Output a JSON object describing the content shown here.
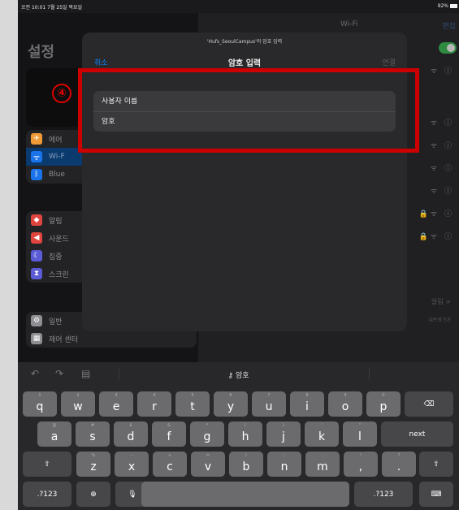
{
  "status": {
    "time": "오전 10:01  7월 25일 목요일",
    "battery": "92%"
  },
  "left": {
    "title": "설정",
    "items_group1": [
      {
        "label": "에어",
        "icon": "airplane-icon",
        "color": "#f09a37"
      },
      {
        "label": "Wi-F",
        "icon": "wifi-icon",
        "color": "#1a73e8"
      },
      {
        "label": "Blue",
        "icon": "bluetooth-icon",
        "color": "#1a73e8"
      }
    ],
    "items_group2": [
      {
        "label": "알림",
        "icon": "bell-icon",
        "color": "#e0443e"
      },
      {
        "label": "사운드",
        "icon": "sound-icon",
        "color": "#e0443e"
      },
      {
        "label": "집중",
        "icon": "moon-icon",
        "color": "#5b5bd6"
      },
      {
        "label": "스크린",
        "icon": "hourglass-icon",
        "color": "#5b5bd6"
      }
    ],
    "items_group3": [
      {
        "label": "일반",
        "icon": "gear-icon",
        "color": "#8e8e93"
      },
      {
        "label": "제어 센터",
        "icon": "control-center-icon",
        "color": "#8e8e93"
      }
    ]
  },
  "right": {
    "title": "Wi-Fi",
    "edit": "편집",
    "bottom_text": "알림 >",
    "small_text": "네트워크가"
  },
  "modal": {
    "subtitle": "'Hufs_SeoulCampus'의 암호 입력",
    "cancel": "취소",
    "title": "암호 입력",
    "join": "연결",
    "username_placeholder": "사용자 이름",
    "password_placeholder": "암호"
  },
  "annotation": {
    "step": "④",
    "box_color": "#cc0000"
  },
  "keyboard": {
    "center_label": "암호",
    "row1": [
      {
        "hint": "1",
        "key": "q"
      },
      {
        "hint": "2",
        "key": "w"
      },
      {
        "hint": "3",
        "key": "e"
      },
      {
        "hint": "4",
        "key": "r"
      },
      {
        "hint": "5",
        "key": "t"
      },
      {
        "hint": "6",
        "key": "y"
      },
      {
        "hint": "7",
        "key": "u"
      },
      {
        "hint": "8",
        "key": "i"
      },
      {
        "hint": "9",
        "key": "o"
      },
      {
        "hint": "0",
        "key": "p"
      }
    ],
    "row2": [
      {
        "hint": "@",
        "key": "a"
      },
      {
        "hint": "#",
        "key": "s"
      },
      {
        "hint": "$",
        "key": "d"
      },
      {
        "hint": "&",
        "key": "f"
      },
      {
        "hint": "*",
        "key": "g"
      },
      {
        "hint": "(",
        "key": "h"
      },
      {
        "hint": ")",
        "key": "j"
      },
      {
        "hint": "'",
        "key": "k"
      },
      {
        "hint": "\"",
        "key": "l"
      }
    ],
    "row3": [
      {
        "hint": "%",
        "key": "z"
      },
      {
        "hint": "-",
        "key": "x"
      },
      {
        "hint": "+",
        "key": "c"
      },
      {
        "hint": "=",
        "key": "v"
      },
      {
        "hint": "/",
        "key": "b"
      },
      {
        "hint": ";",
        "key": "n"
      },
      {
        "hint": ":",
        "key": "m"
      },
      {
        "hint": "!",
        "key": ","
      },
      {
        "hint": "?",
        "key": "."
      }
    ],
    "next_label": "next",
    "numbers_label": ".?123"
  }
}
